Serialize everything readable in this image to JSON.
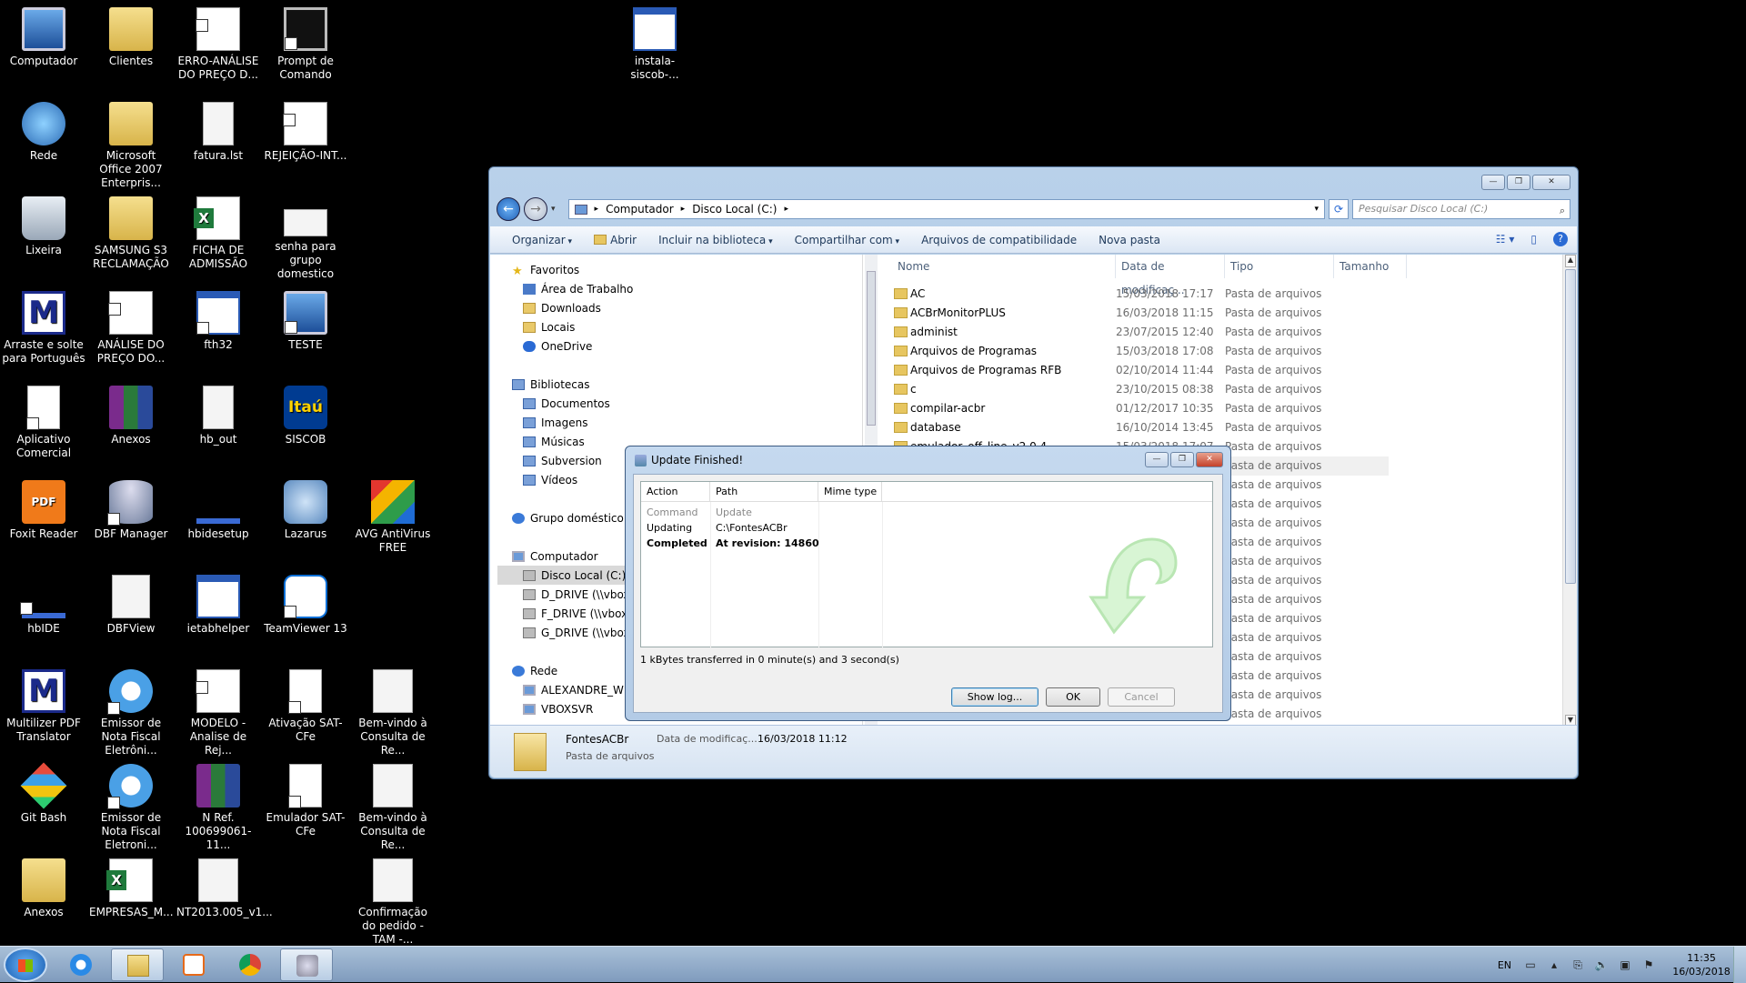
{
  "desktop": {
    "icons": [
      {
        "label": "Computador"
      },
      {
        "label": "Clientes"
      },
      {
        "label": "ERRO-ANÁLISE DO PREÇO D..."
      },
      {
        "label": "Prompt de Comando"
      },
      {
        "label": "instala-siscob-..."
      },
      {
        "label": "Rede"
      },
      {
        "label": "Microsoft Office 2007 Enterpris..."
      },
      {
        "label": "fatura.lst"
      },
      {
        "label": "REJEIÇÃO-INT..."
      },
      {
        "label": "Lixeira"
      },
      {
        "label": "SAMSUNG S3 RECLAMAÇÃO"
      },
      {
        "label": "FICHA DE ADMISSÃO"
      },
      {
        "label": "senha para grupo domestico"
      },
      {
        "label": "Arraste e solte para Português"
      },
      {
        "label": "ANÁLISE DO PREÇO DO..."
      },
      {
        "label": "fth32"
      },
      {
        "label": "TESTE"
      },
      {
        "label": "Aplicativo Comercial"
      },
      {
        "label": "Anexos"
      },
      {
        "label": "hb_out"
      },
      {
        "label": "SISCOB"
      },
      {
        "label": "Foxit Reader"
      },
      {
        "label": "DBF Manager"
      },
      {
        "label": "hbidesetup"
      },
      {
        "label": "Lazarus"
      },
      {
        "label": "AVG AntiVirus FREE"
      },
      {
        "label": "hbIDE"
      },
      {
        "label": "DBFView"
      },
      {
        "label": "ietabhelper"
      },
      {
        "label": "TeamViewer 13"
      },
      {
        "label": "Multilizer PDF Translator"
      },
      {
        "label": "Emissor de Nota Fiscal Eletrôni..."
      },
      {
        "label": "MODELO - Analise de Rej..."
      },
      {
        "label": "Ativação SAT-CFe"
      },
      {
        "label": "Bem-vindo à Consulta de Re..."
      },
      {
        "label": "Git Bash"
      },
      {
        "label": "Emissor de Nota Fiscal Eletroni..."
      },
      {
        "label": "N Ref. 100699061-11..."
      },
      {
        "label": "Emulador SAT-CFe"
      },
      {
        "label": "Bem-vindo à Consulta de Re..."
      },
      {
        "label": "Anexos"
      },
      {
        "label": "EMPRESAS_M..."
      },
      {
        "label": "NT2013.005_v1..."
      },
      {
        "label": "Confirmação do pedido - TAM -..."
      }
    ]
  },
  "explorer": {
    "breadcrumb": [
      "Computador",
      "Disco Local (C:)"
    ],
    "search_placeholder": "Pesquisar Disco Local (C:)",
    "toolbar": {
      "organize": "Organizar",
      "open": "Abrir",
      "include": "Incluir na biblioteca",
      "share": "Compartilhar com",
      "compat": "Arquivos de compatibilidade",
      "newfolder": "Nova pasta"
    },
    "nav": {
      "favorites": "Favoritos",
      "fav_items": [
        "Área de Trabalho",
        "Downloads",
        "Locais",
        "OneDrive"
      ],
      "libraries": "Bibliotecas",
      "lib_items": [
        "Documentos",
        "Imagens",
        "Músicas",
        "Subversion",
        "Vídeos"
      ],
      "homegroup": "Grupo doméstico",
      "computer": "Computador",
      "drives": [
        "Disco Local (C:)",
        "D_DRIVE (\\\\vboxs",
        "F_DRIVE (\\\\vboxs",
        "G_DRIVE (\\\\vboxs"
      ],
      "network": "Rede",
      "net_items": [
        "ALEXANDRE_WIN",
        "VBOXSVR"
      ]
    },
    "columns": {
      "name": "Nome",
      "date": "Data de modificaç...",
      "type": "Tipo",
      "size": "Tamanho"
    },
    "files": [
      {
        "name": "AC",
        "date": "15/03/2018 17:17",
        "type": "Pasta de arquivos"
      },
      {
        "name": "ACBrMonitorPLUS",
        "date": "16/03/2018 11:15",
        "type": "Pasta de arquivos"
      },
      {
        "name": "administ",
        "date": "23/07/2015 12:40",
        "type": "Pasta de arquivos"
      },
      {
        "name": "Arquivos de Programas",
        "date": "15/03/2018 17:08",
        "type": "Pasta de arquivos"
      },
      {
        "name": "Arquivos de Programas RFB",
        "date": "02/10/2014 11:44",
        "type": "Pasta de arquivos"
      },
      {
        "name": "c",
        "date": "23/10/2015 08:38",
        "type": "Pasta de arquivos"
      },
      {
        "name": "compilar-acbr",
        "date": "01/12/2017 10:35",
        "type": "Pasta de arquivos"
      },
      {
        "name": "database",
        "date": "16/10/2014 13:45",
        "type": "Pasta de arquivos"
      },
      {
        "name": "emulador_off_line_v2.0.4",
        "date": "15/03/2018 17:07",
        "type": "Pasta de arquivos"
      }
    ],
    "type_only": "Pasta de arquivos",
    "details": {
      "name": "FontesACBr",
      "date_label": "Data de modificaç...",
      "date": "16/03/2018 11:12",
      "type": "Pasta de arquivos"
    }
  },
  "dialog": {
    "title": "Update Finished!",
    "columns": {
      "action": "Action",
      "path": "Path",
      "mime": "Mime type"
    },
    "rows": [
      {
        "action": "Command",
        "path": "Update"
      },
      {
        "action": "Updating",
        "path": "C:\\FontesACBr"
      },
      {
        "action": "Completed",
        "path": "At revision: 14860"
      }
    ],
    "status": "1 kBytes transferred in 0 minute(s) and 3 second(s)",
    "buttons": {
      "log": "Show log...",
      "ok": "OK",
      "cancel": "Cancel"
    }
  },
  "taskbar": {
    "lang": "EN",
    "time": "11:35",
    "date": "16/03/2018"
  }
}
